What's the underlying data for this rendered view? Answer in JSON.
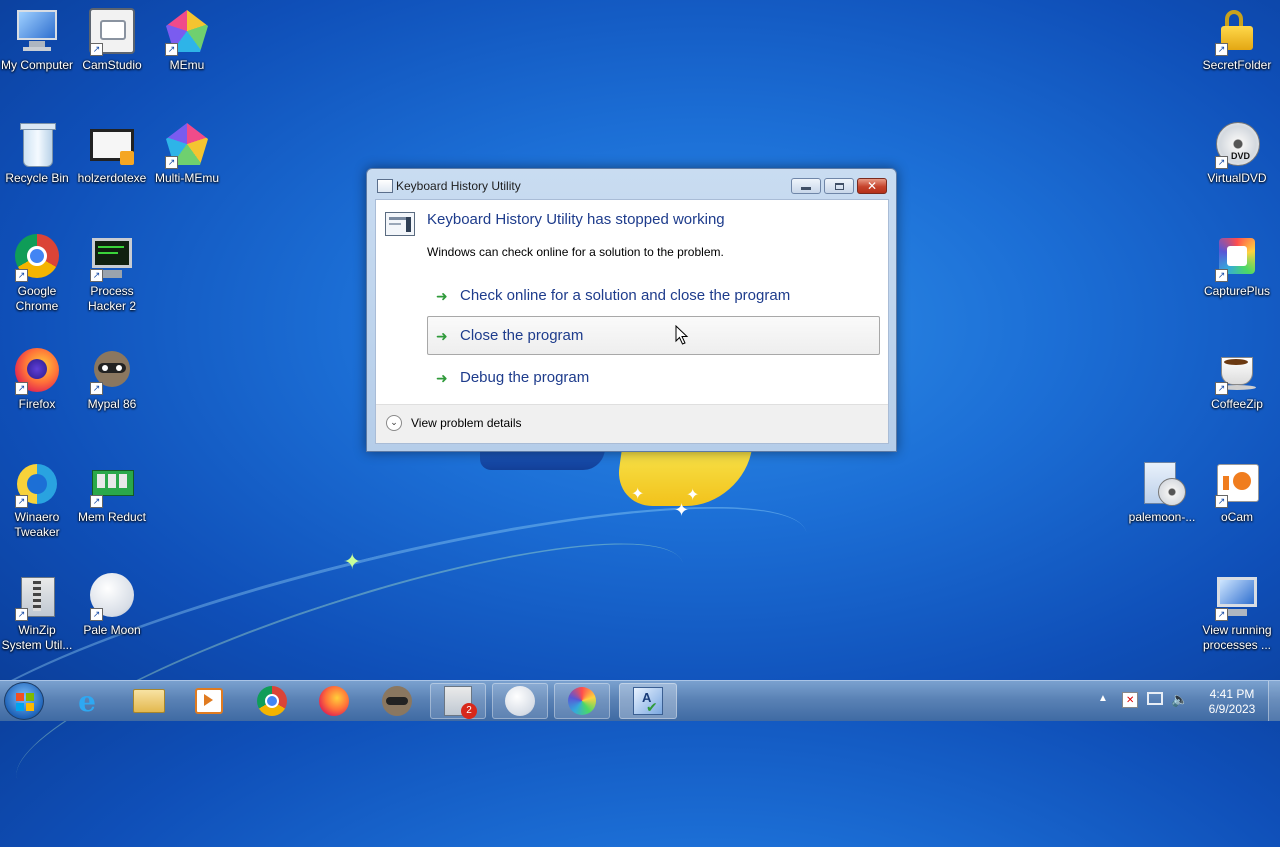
{
  "desktop": {
    "icons_left": [
      {
        "label": "My Computer",
        "icon": "computer-icon"
      },
      {
        "label": "CamStudio",
        "icon": "camstudio-icon"
      },
      {
        "label": "MEmu",
        "icon": "memu-icon"
      },
      {
        "label": "Recycle Bin",
        "icon": "recycle-bin-icon"
      },
      {
        "label": "holzerdotexe",
        "icon": "video-file-icon"
      },
      {
        "label": "Multi-MEmu",
        "icon": "multi-memu-icon"
      },
      {
        "label": "Google Chrome",
        "icon": "chrome-icon"
      },
      {
        "label": "Process Hacker 2",
        "icon": "process-hacker-icon"
      },
      {
        "label": "Firefox",
        "icon": "firefox-icon"
      },
      {
        "label": "Mypal 86",
        "icon": "mypal-icon"
      },
      {
        "label": "Winaero Tweaker",
        "icon": "winaero-icon"
      },
      {
        "label": "Mem Reduct",
        "icon": "mem-reduct-icon"
      },
      {
        "label": "WinZip System Util...",
        "icon": "winzip-icon"
      },
      {
        "label": "Pale Moon",
        "icon": "pale-moon-icon"
      }
    ],
    "icons_right": [
      {
        "label": "SecretFolder",
        "icon": "lock-folder-icon"
      },
      {
        "label": "VirtualDVD",
        "icon": "dvd-icon"
      },
      {
        "label": "CapturePlus",
        "icon": "captureplus-icon"
      },
      {
        "label": "CoffeeZip",
        "icon": "coffeezip-icon"
      },
      {
        "label": "palemoon-...",
        "icon": "installer-icon"
      },
      {
        "label": "oCam",
        "icon": "ocam-icon"
      },
      {
        "label": "View running processes ...",
        "icon": "processes-icon"
      }
    ]
  },
  "dialog": {
    "title": "Keyboard History Utility",
    "heading": "Keyboard History Utility has stopped working",
    "message": "Windows can check online for a solution to the problem.",
    "options": [
      {
        "label": "Check online for a solution and close the program"
      },
      {
        "label": "Close the program"
      },
      {
        "label": "Debug the program"
      }
    ],
    "details_label": "View problem details",
    "close_glyph": "✕"
  },
  "taskbar": {
    "badge_count": "2",
    "clock_time": "4:41 PM",
    "clock_date": "6/9/2023"
  },
  "colors": {
    "heading_blue": "#1e3c8c",
    "arrow_green": "#2f9a3a",
    "close_red": "#c6432c"
  }
}
